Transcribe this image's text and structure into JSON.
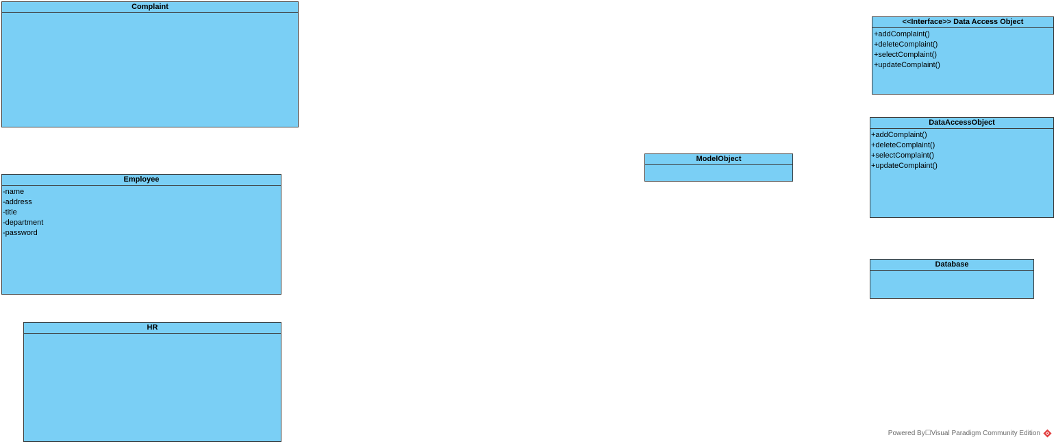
{
  "classes": {
    "complaint": {
      "name": "Complaint",
      "members": []
    },
    "employee": {
      "name": "Employee",
      "members": [
        "-name",
        "-address",
        "-title",
        "-department",
        "-password"
      ]
    },
    "hr": {
      "name": "HR",
      "members": []
    },
    "model_object": {
      "name": "ModelObject",
      "members": []
    },
    "interface_dao": {
      "name": "<<Interface>> Data Access Object",
      "members": [
        "+addComplaint()",
        "+deleteComplaint()",
        "+selectComplaint()",
        "+updateComplaint()"
      ]
    },
    "dao": {
      "name": "DataAccessObject",
      "members": [
        "+addComplaint()",
        "+deleteComplaint()",
        "+selectComplaint()",
        "+updateComplaint()"
      ]
    },
    "database": {
      "name": "Database",
      "members": []
    }
  },
  "footer": {
    "text": "Powered By☐Visual Paradigm Community Edition"
  },
  "colors": {
    "class_fill": "#7ACFF5",
    "border": "#3c3c3c",
    "logo": "#e23d3d"
  },
  "icons": {
    "footer_logo": "visual-paradigm-logo-icon"
  }
}
